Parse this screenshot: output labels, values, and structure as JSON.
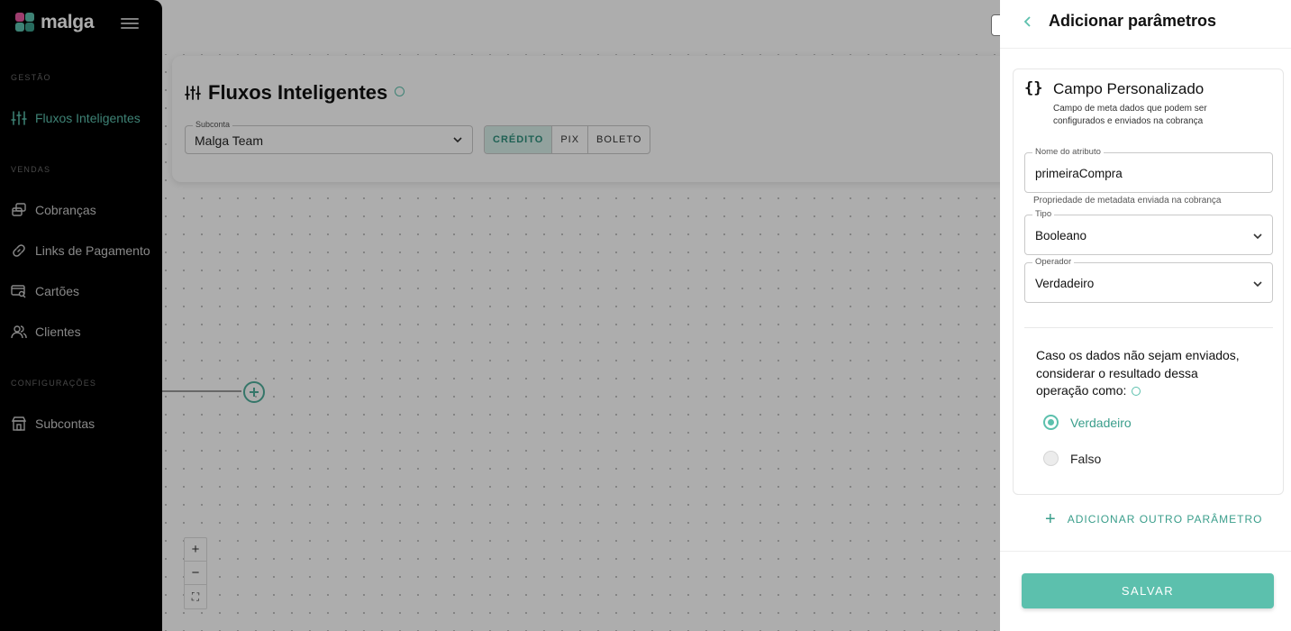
{
  "brand": {
    "name": "malga",
    "accent": "#5cc0ad"
  },
  "sidebar": {
    "sections": [
      {
        "title": "GESTÃO"
      },
      {
        "title": "VENDAS"
      },
      {
        "title": "CONFIGURAÇÕES"
      }
    ],
    "items": [
      {
        "label": "Fluxos Inteligentes",
        "icon": "sliders-icon",
        "active": true
      },
      {
        "label": "Cobranças",
        "icon": "charges-icon"
      },
      {
        "label": "Links de Pagamento",
        "icon": "link-icon"
      },
      {
        "label": "Cartões",
        "icon": "card-search-icon"
      },
      {
        "label": "Clientes",
        "icon": "users-icon"
      },
      {
        "label": "Subcontas",
        "icon": "store-icon"
      }
    ]
  },
  "main": {
    "title": "Fluxos Inteligentes",
    "subaccount": {
      "label": "Subconta",
      "value": "Malga Team"
    },
    "payment_methods": [
      "CRÉDITO",
      "PIX",
      "BOLETO"
    ],
    "selected_method": "CRÉDITO",
    "zoom": {
      "in": "+",
      "out": "−",
      "fit": "⛶"
    }
  },
  "drawer": {
    "title": "Adicionar parâmetros",
    "card": {
      "icon_text": "{}",
      "title": "Campo Personalizado",
      "subtitle": "Campo de meta dados que podem ser configurados e enviados na cobrança"
    },
    "attribute": {
      "label": "Nome do atributo",
      "value": "primeiraCompra",
      "helper": "Propriedade de metadata enviada na cobrança"
    },
    "type": {
      "label": "Tipo",
      "value": "Booleano"
    },
    "operator": {
      "label": "Operador",
      "value": "Verdadeiro"
    },
    "fallback_question": "Caso os dados não sejam enviados, considerar o resultado dessa operação como:",
    "options": [
      {
        "label": "Verdadeiro",
        "selected": true
      },
      {
        "label": "Falso",
        "selected": false
      }
    ],
    "add_param_label": "ADICIONAR OUTRO PARÂMETRO",
    "save_label": "SALVAR"
  }
}
